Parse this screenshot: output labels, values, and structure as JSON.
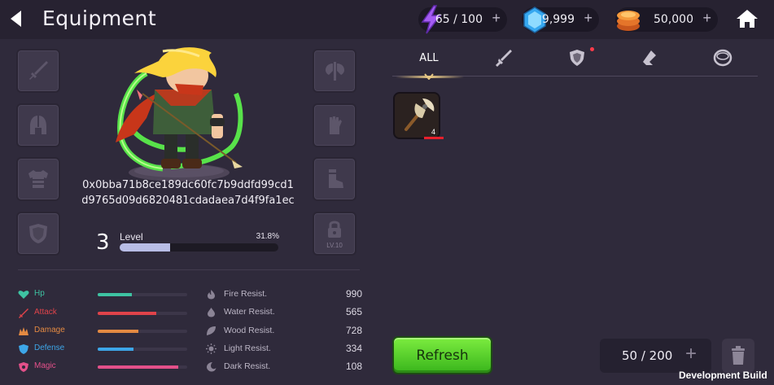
{
  "header": {
    "title": "Equipment",
    "energy": "65 / 100",
    "gems": "9,999",
    "gold": "50,000",
    "plus": "+"
  },
  "hero": {
    "name": "0x0bba71b8ce189dc60fc7b9ddfd99cd1d9765d09d6820481cdadaea7d4f9fa1ec",
    "level": "3",
    "level_label": "Level",
    "level_pct_text": "31.8%",
    "level_progress": 0.318
  },
  "slots": {
    "locked_level": "LV.10"
  },
  "stats": [
    {
      "label": "Hp",
      "color": "#3ec3a2",
      "fill": 0.38
    },
    {
      "label": "Attack",
      "color": "#e0434a",
      "fill": 0.65
    },
    {
      "label": "Damage",
      "color": "#e48a42",
      "fill": 0.45
    },
    {
      "label": "Defense",
      "color": "#3da6e8",
      "fill": 0.4
    },
    {
      "label": "Magic",
      "color": "#e4508a",
      "fill": 0.9
    }
  ],
  "resists": [
    {
      "label": "Fire Resist.",
      "value": "990"
    },
    {
      "label": "Water Resist.",
      "value": "565"
    },
    {
      "label": "Wood Resist.",
      "value": "728"
    },
    {
      "label": "Light Resist.",
      "value": "334"
    },
    {
      "label": "Dark Resist.",
      "value": "108"
    }
  ],
  "inventory": {
    "tabs": {
      "all": "ALL"
    },
    "items": [
      {
        "icon": "battle-axe-icon",
        "count": "4"
      }
    ],
    "refresh_label": "Refresh",
    "capacity": "50 / 200",
    "capacity_plus": "+"
  },
  "footer": {
    "dev_build": "Development Build"
  }
}
